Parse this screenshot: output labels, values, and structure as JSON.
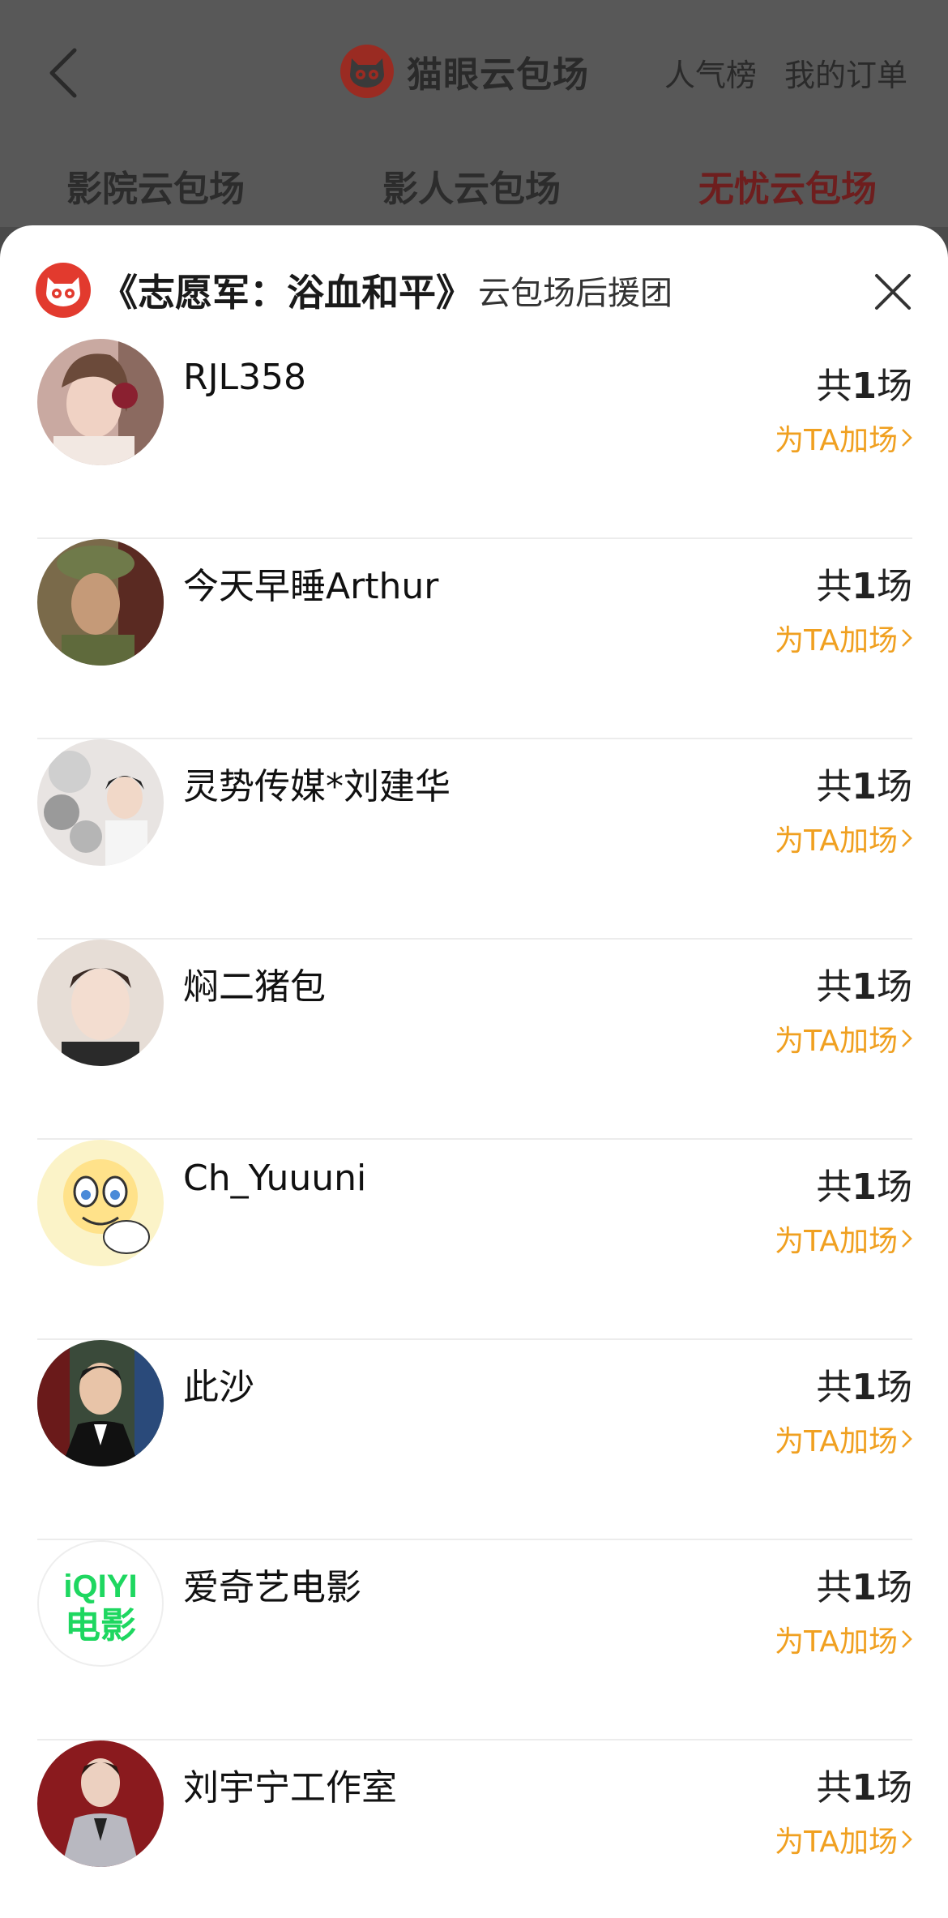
{
  "header": {
    "brand_title": "猫眼云包场",
    "link_ranking": "人气榜",
    "link_orders": "我的订单"
  },
  "tabs": [
    {
      "label": "影院云包场",
      "active": false
    },
    {
      "label": "影人云包场",
      "active": false
    },
    {
      "label": "无忧云包场",
      "active": true
    }
  ],
  "sheet": {
    "movie_title": "《志愿军：浴血和平》",
    "subtitle": "云包场后援团"
  },
  "list_items": [
    {
      "name": "RJL358",
      "count_prefix": "共",
      "count_number": "1",
      "count_suffix": "场",
      "action": "为TA加场"
    },
    {
      "name": "今天早睡Arthur",
      "count_prefix": "共",
      "count_number": "1",
      "count_suffix": "场",
      "action": "为TA加场"
    },
    {
      "name": "灵势传媒*刘建华",
      "count_prefix": "共",
      "count_number": "1",
      "count_suffix": "场",
      "action": "为TA加场"
    },
    {
      "name": "焖二猪包",
      "count_prefix": "共",
      "count_number": "1",
      "count_suffix": "场",
      "action": "为TA加场"
    },
    {
      "name": "Ch_Yuuuni",
      "count_prefix": "共",
      "count_number": "1",
      "count_suffix": "场",
      "action": "为TA加场"
    },
    {
      "name": "此沙",
      "count_prefix": "共",
      "count_number": "1",
      "count_suffix": "场",
      "action": "为TA加场"
    },
    {
      "name": "爱奇艺电影",
      "count_prefix": "共",
      "count_number": "1",
      "count_suffix": "场",
      "action": "为TA加场"
    },
    {
      "name": "刘宇宁工作室",
      "count_prefix": "共",
      "count_number": "1",
      "count_suffix": "场",
      "action": "为TA加场"
    }
  ],
  "avatars": {
    "iqiyi_line1": "iQIYI",
    "iqiyi_line2": "电影"
  },
  "colors": {
    "accent_orange": "#f0a020",
    "brand_red": "#e23a2e",
    "active_tab": "#6e1e1e"
  }
}
